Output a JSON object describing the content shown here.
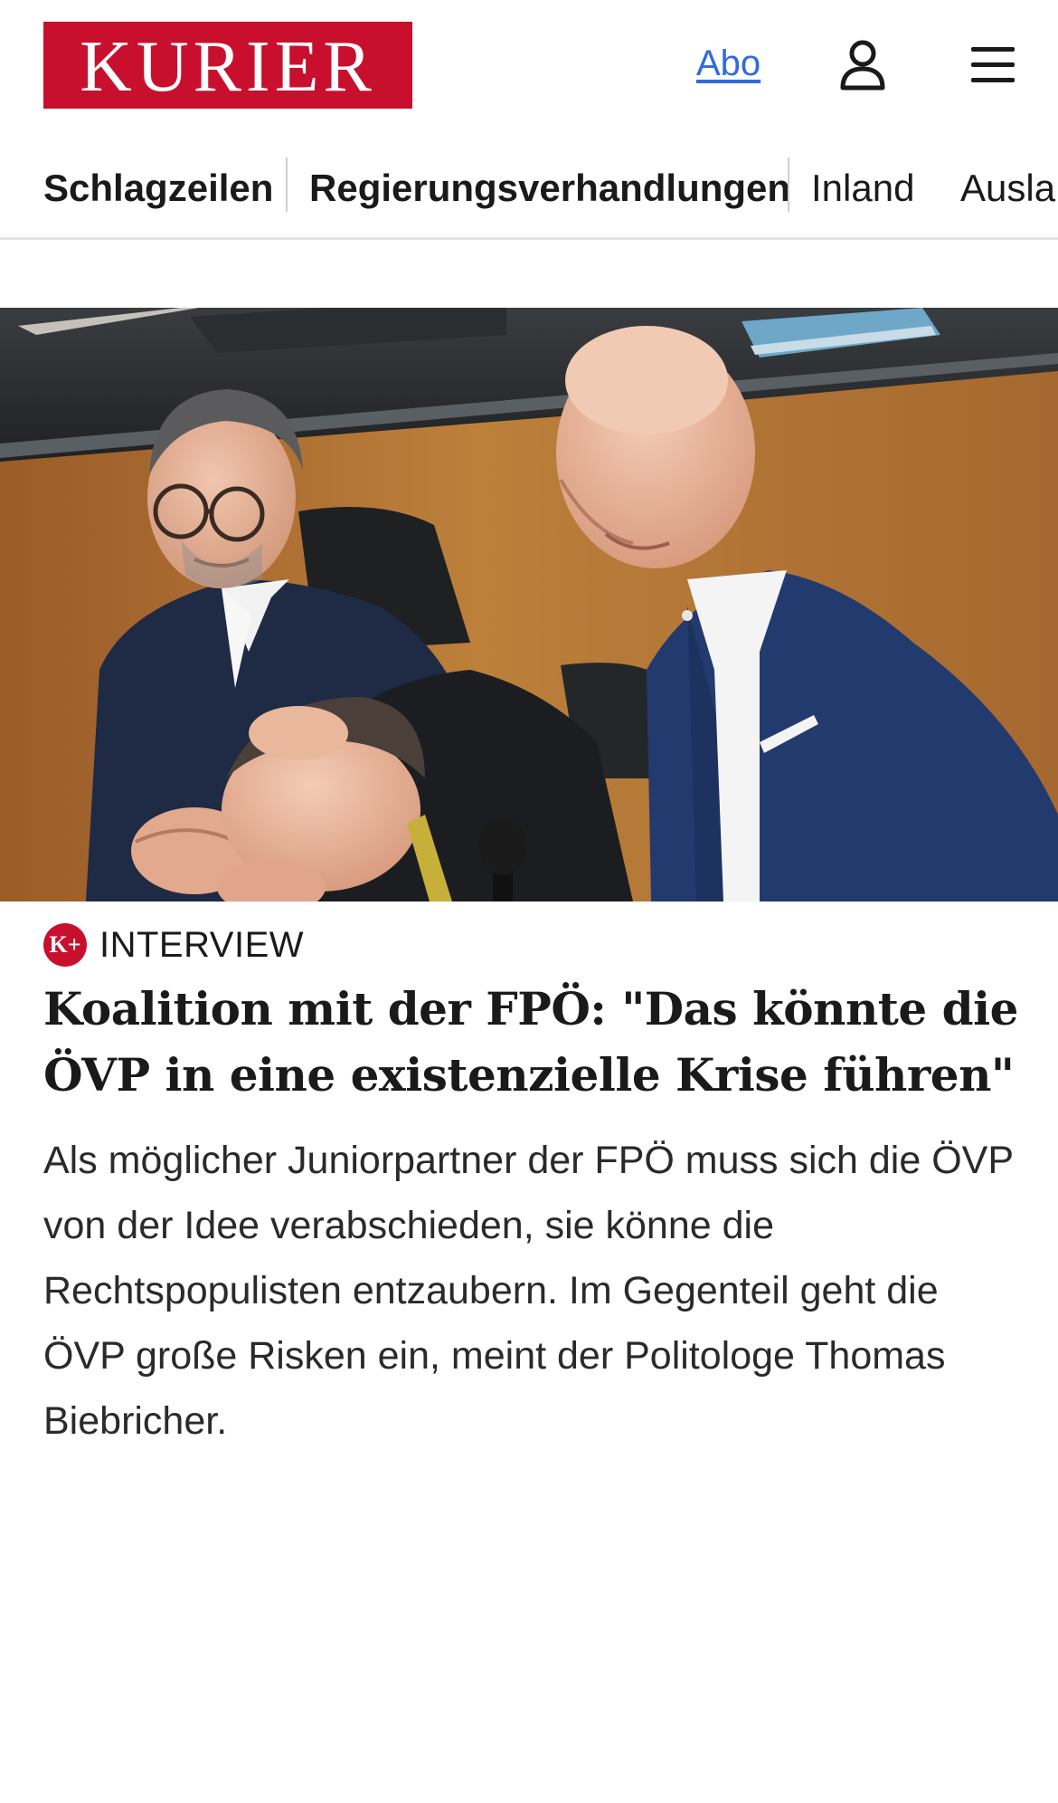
{
  "header": {
    "logo_text": "KURIER",
    "abo_label": "Abo",
    "user_icon": "user-icon",
    "menu_icon": "menu-icon"
  },
  "nav": {
    "items": [
      {
        "label": "Schlagzeilen"
      },
      {
        "label": "Regierungsverhandlungen"
      },
      {
        "label": "Inland"
      },
      {
        "label": "Ausla"
      }
    ]
  },
  "article": {
    "badge": "K+",
    "kicker": "INTERVIEW",
    "headline": "Koalition mit der FPÖ: \"Das könnte die ÖVP in eine existenzielle Krise führen\"",
    "teaser": "Als möglicher Juniorpartner der FPÖ muss sich die ÖVP von der Idee verabschieden, sie könne die Rechtspopulisten entzaubern. Im Gegenteil geht die ÖVP große Risken ein, meint der Politologe Thomas Biebricher."
  },
  "colors": {
    "brand_red": "#c8102e",
    "link_blue": "#2f6ae0",
    "text": "#1a1a1a"
  }
}
